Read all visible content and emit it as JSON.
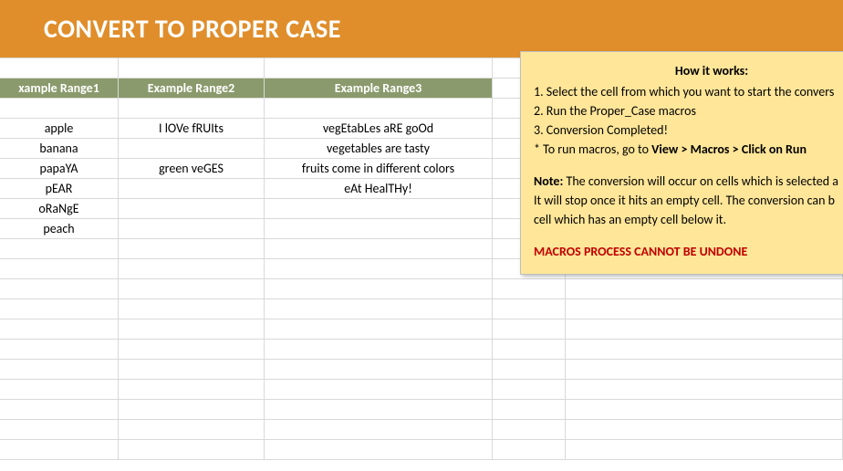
{
  "title": "CONVERT TO PROPER CASE",
  "headers": {
    "col1": "xample Range1",
    "col2": "Example Range2",
    "col3": "Example Range3"
  },
  "rows": [
    {
      "c1": "apple",
      "c2": "I lOVe fRUIts",
      "c3": "vegEtabLes aRE goOd"
    },
    {
      "c1": "banana",
      "c2": "",
      "c3": "vegetables are tasty"
    },
    {
      "c1": "papaYA",
      "c2": "green veGES",
      "c3": "fruits come in different colors"
    },
    {
      "c1": "pEAR",
      "c2": "",
      "c3": "eAt HealTHy!"
    },
    {
      "c1": "oRaNgE",
      "c2": "",
      "c3": ""
    },
    {
      "c1": "peach",
      "c2": "",
      "c3": ""
    }
  ],
  "callout": {
    "title": "How it works:",
    "step1": "1. Select the cell from which you want to start the convers",
    "step2": "2. Run the Proper_Case macros",
    "step3": "3. Conversion Completed!",
    "hint_prefix": "   * To run macros, go to ",
    "hint_bold": "View > Macros > Click on Run",
    "note_label": "Note:",
    "note_text1": " The conversion will occur on cells which is selected a",
    "note_text2": "It will stop once it hits an empty cell. The conversion can b",
    "note_text3": "cell which has an empty cell below it.",
    "warning": "MACROS PROCESS CANNOT BE UNDONE"
  }
}
